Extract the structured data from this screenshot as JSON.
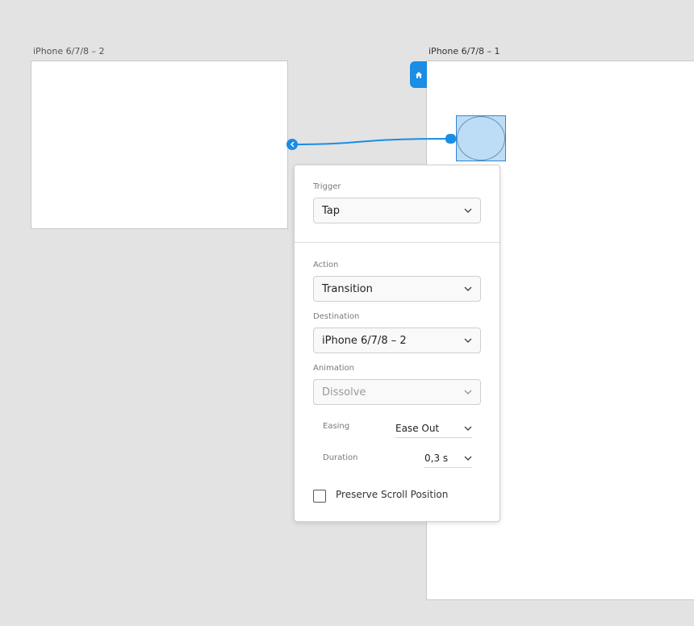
{
  "artboards": {
    "secondary_label": "iPhone 6/7/8 – 2",
    "primary_label": "iPhone 6/7/8 – 1"
  },
  "colors": {
    "accent": "#1a8de4",
    "selection_fill": "#bddcf6",
    "canvas": "#e3e3e3"
  },
  "icons": {
    "home": "home-icon",
    "back": "chevron-left-icon",
    "dropdown": "chevron-down-icon"
  },
  "panel": {
    "trigger": {
      "label": "Trigger",
      "value": "Tap"
    },
    "action": {
      "label": "Action",
      "value": "Transition"
    },
    "destination": {
      "label": "Destination",
      "value": "iPhone 6/7/8 – 2"
    },
    "animation": {
      "label": "Animation",
      "value": "Dissolve"
    },
    "easing": {
      "label": "Easing",
      "value": "Ease Out"
    },
    "duration": {
      "label": "Duration",
      "value": "0,3 s"
    },
    "preserve_scroll": {
      "label": "Preserve Scroll Position",
      "checked": false
    }
  }
}
